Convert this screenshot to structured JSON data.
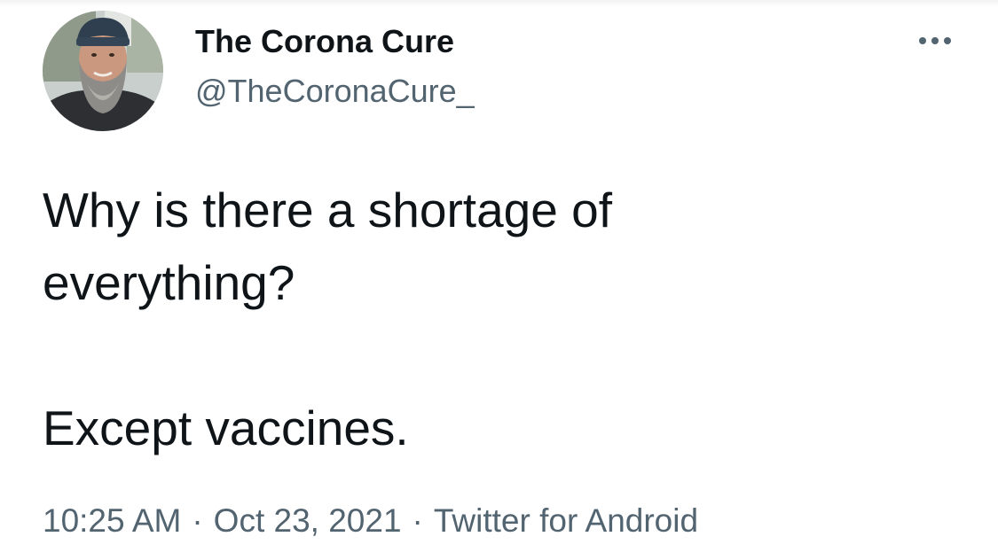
{
  "tweet": {
    "author": {
      "display_name": "The Corona Cure",
      "handle": "@TheCoronaCure_",
      "avatar_icon": "profile-photo-avatar"
    },
    "more_icon": "more-options-icon",
    "text_lines": [
      "Why is there a shortage of",
      "everything?",
      "Except vaccines."
    ],
    "meta": {
      "time": "10:25 AM",
      "separator": "·",
      "date": "Oct 23, 2021",
      "source": "Twitter for Android"
    }
  },
  "colors": {
    "text": "#0f1419",
    "secondary": "#536471",
    "background": "#ffffff"
  }
}
